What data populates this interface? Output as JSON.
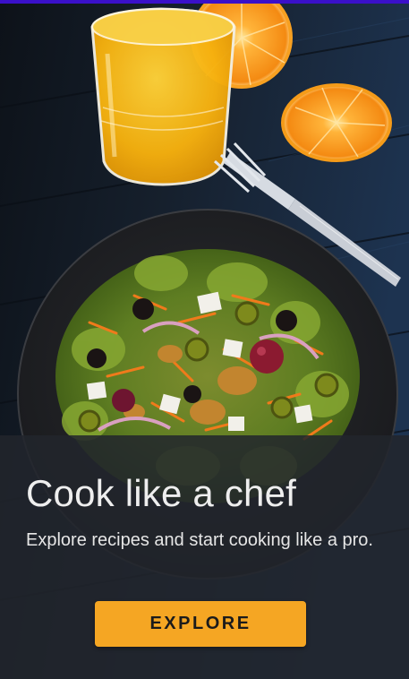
{
  "onboarding": {
    "headline": "Cook like a chef",
    "subtitle": "Explore recipes and start cooking like a pro.",
    "explore_label": "EXPLORE"
  },
  "colors": {
    "status_accent": "#3a10c9",
    "button_background": "#f5a623",
    "overlay": "#22252c"
  }
}
